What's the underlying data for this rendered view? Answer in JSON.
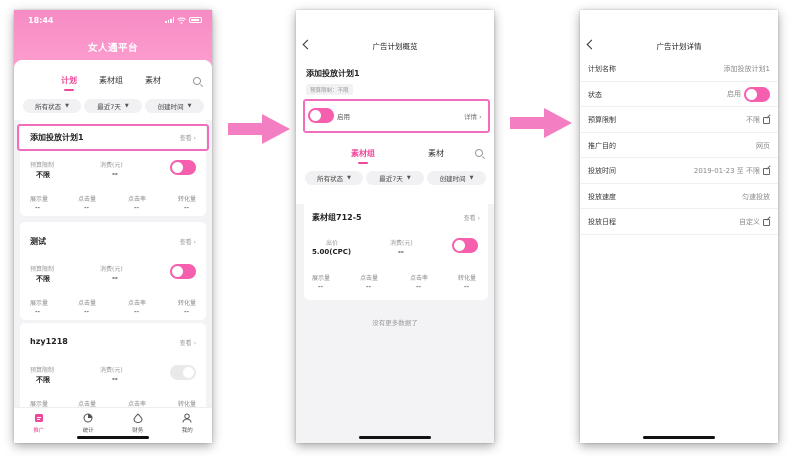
{
  "colors": {
    "accent": "#f0479b",
    "header": "#f58bc3",
    "highlight": "#f26dbb",
    "arrow": "#f47ec2"
  },
  "screen1": {
    "status_time": "18:44",
    "title": "女人通平台",
    "tabs": [
      "计划",
      "素材组",
      "素材"
    ],
    "active_tab": "计划",
    "filters": [
      "所有状态",
      "最近7天",
      "创建时间"
    ],
    "view_label": "查看",
    "budget_label": "预算限制",
    "spend_label": "消费(元)",
    "stat_labels": [
      "展示量",
      "点击量",
      "点击率",
      "转化量"
    ],
    "plans": [
      {
        "name": "添加投放计划1",
        "budget": "不限",
        "spend": "--",
        "enabled": true,
        "stats": [
          "--",
          "--",
          "--",
          "--"
        ]
      },
      {
        "name": "测试",
        "budget": "不限",
        "spend": "--",
        "enabled": true,
        "stats": [
          "--",
          "--",
          "--",
          "--"
        ]
      },
      {
        "name": "hzy1218",
        "budget": "不限",
        "spend": "--",
        "enabled": false,
        "stats": [
          "--",
          "--",
          "--",
          "--"
        ]
      }
    ],
    "nav": [
      {
        "label": "推广",
        "icon": "promote-icon",
        "active": true
      },
      {
        "label": "统计",
        "icon": "stats-icon",
        "active": false
      },
      {
        "label": "财务",
        "icon": "finance-icon",
        "active": false
      },
      {
        "label": "我的",
        "icon": "profile-icon",
        "active": false
      }
    ]
  },
  "screen2": {
    "title": "广告计划概览",
    "plan_name": "添加投放计划1",
    "budget_badge": "预算限制：不限",
    "enable_label": "启用",
    "detail_label": "详情",
    "tabs": [
      "素材组",
      "素材"
    ],
    "active_tab": "素材组",
    "filters": [
      "所有状态",
      "最近7天",
      "创建时间"
    ],
    "group": {
      "name": "素材组712-5",
      "view_label": "查看",
      "bid_label": "出价",
      "bid_value": "5.00(CPC)",
      "spend_label": "消费(元)",
      "spend_value": "--",
      "enabled": true,
      "stat_labels": [
        "展示量",
        "点击量",
        "点击率",
        "转化量"
      ],
      "stats": [
        "--",
        "--",
        "--",
        "--"
      ]
    },
    "no_more": "没有更多数据了"
  },
  "screen3": {
    "title": "广告计划详情",
    "rows": [
      {
        "key": "计划名称",
        "value": "添加投放计划1",
        "editable": false
      },
      {
        "key": "状态",
        "value": "启用",
        "toggle": true
      },
      {
        "key": "预算限制",
        "value": "不限",
        "editable": true
      },
      {
        "key": "推广目的",
        "value": "网页",
        "editable": false
      },
      {
        "key": "投放时间",
        "value": "2019-01-23 至 不限",
        "editable": true
      },
      {
        "key": "投放速度",
        "value": "匀速投放",
        "editable": false
      },
      {
        "key": "投放日程",
        "value": "自定义",
        "editable": true
      }
    ]
  }
}
